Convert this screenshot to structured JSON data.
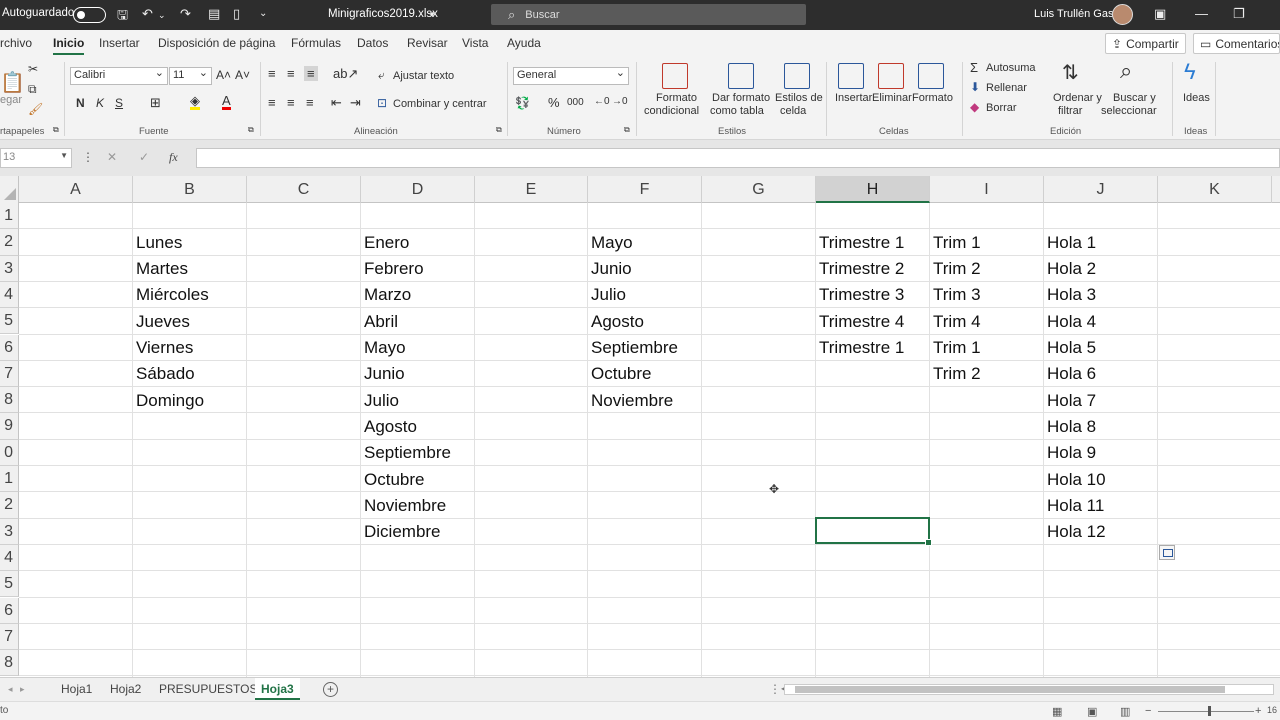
{
  "titlebar": {
    "autosave_label": "Autoguardado",
    "file_name": "Minigraficos2019.xlsx",
    "search_placeholder": "Buscar",
    "user_name": "Luis Trullén Gas"
  },
  "menu": {
    "items": [
      "rchivo",
      "Inicio",
      "Insertar",
      "Disposición de página",
      "Fórmulas",
      "Datos",
      "Revisar",
      "Vista",
      "Ayuda"
    ],
    "active": "Inicio",
    "share_label": "Compartir",
    "comments_label": "Comentarios"
  },
  "ribbon": {
    "paste_label": "egar",
    "clipboard_group": "rtapapeles",
    "font_name": "Calibri",
    "font_size": "11",
    "font_group": "Fuente",
    "bold": "N",
    "italic": "K",
    "underline": "S",
    "wrap_text": "Ajustar texto",
    "merge_center": "Combinar y centrar",
    "alignment_group": "Alineación",
    "number_format": "General",
    "number_group": "Número",
    "cond_format_1": "Formato",
    "cond_format_2": "condicional",
    "format_table_1": "Dar formato",
    "format_table_2": "como tabla",
    "cell_styles_1": "Estilos de",
    "cell_styles_2": "celda",
    "styles_group": "Estilos",
    "insert": "Insertar",
    "delete": "Eliminar",
    "format": "Formato",
    "cells_group": "Celdas",
    "autosum": "Autosuma",
    "fill": "Rellenar",
    "clear": "Borrar",
    "sort_filter_1": "Ordenar y",
    "sort_filter_2": "filtrar",
    "find_select_1": "Buscar y",
    "find_select_2": "seleccionar",
    "editing_group": "Edición",
    "ideas": "Ideas",
    "ideas_group": "Ideas"
  },
  "formula_bar": {
    "name_box": "13",
    "fx_label": "fx",
    "value": ""
  },
  "sheet": {
    "columns": [
      "A",
      "B",
      "C",
      "D",
      "E",
      "F",
      "G",
      "H",
      "I",
      "J",
      "K"
    ],
    "selected_column": "H",
    "row_labels": [
      "1",
      "2",
      "3",
      "4",
      "5",
      "6",
      "7",
      "8",
      "9",
      "0",
      "1",
      "2",
      "3",
      "4",
      "5",
      "6",
      "7",
      "8"
    ],
    "col_B": [
      "Lunes",
      "Martes",
      "Miércoles",
      "Jueves",
      "Viernes",
      "Sábado",
      "Domingo"
    ],
    "col_D": [
      "Enero",
      "Febrero",
      "Marzo",
      "Abril",
      "Mayo",
      "Junio",
      "Julio",
      "Agosto",
      "Septiembre",
      "Octubre",
      "Noviembre",
      "Diciembre"
    ],
    "col_F": [
      "Mayo",
      "Junio",
      "Julio",
      "Agosto",
      "Septiembre",
      "Octubre",
      "Noviembre"
    ],
    "col_H": [
      "Trimestre 1",
      "Trimestre 2",
      "Trimestre 3",
      "Trimestre 4",
      "Trimestre 1"
    ],
    "col_I": [
      "Trim 1",
      "Trim 2",
      "Trim 3",
      "Trim 4",
      "Trim 1",
      "Trim 2"
    ],
    "col_J": [
      "Hola 1",
      "Hola 2",
      "Hola 3",
      "Hola 4",
      "Hola 5",
      "Hola 6",
      "Hola 7",
      "Hola 8",
      "Hola 9",
      "Hola 10",
      "Hola 11",
      "Hola 12"
    ]
  },
  "tabs": {
    "items": [
      "Hoja1",
      "Hoja2",
      "PRESUPUESTOS",
      "Hoja3"
    ],
    "active": "Hoja3"
  },
  "status": {
    "left": "to",
    "zoom": "16"
  },
  "colors": {
    "accent": "#217346",
    "titlebar": "#2d2d2d",
    "ribbon_bg": "#f3f3f3"
  }
}
